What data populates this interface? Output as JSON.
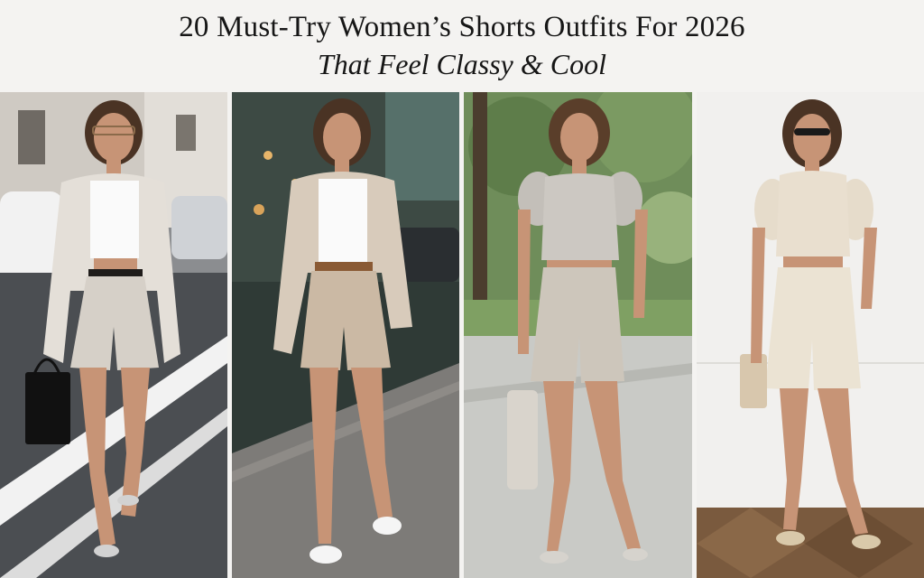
{
  "header": {
    "title": "20 Must-Try Women’s Shorts Outfits For 2026",
    "subtitle": "That Feel Classy & Cool"
  },
  "photos": [
    {
      "scene": "city street",
      "look": "cream blazer, white crop top, grey shorts, black belt, black tote, metallic sandals"
    },
    {
      "scene": "storefront sidewalk",
      "look": "beige blazer, white tank, khaki shorts, brown belt, white sneakers"
    },
    {
      "scene": "park path",
      "look": "grey puff-sleeve top, grey pleated shorts, tote bag, silver slides"
    },
    {
      "scene": "white wall interior",
      "look": "champagne satin tie-front blouse, cream shorts, clutch, metallic heeled sandals"
    }
  ],
  "colors": {
    "background": "#f4f3f1",
    "title_text": "#161616",
    "skin": "#c79476",
    "hair": "#4a3324"
  }
}
